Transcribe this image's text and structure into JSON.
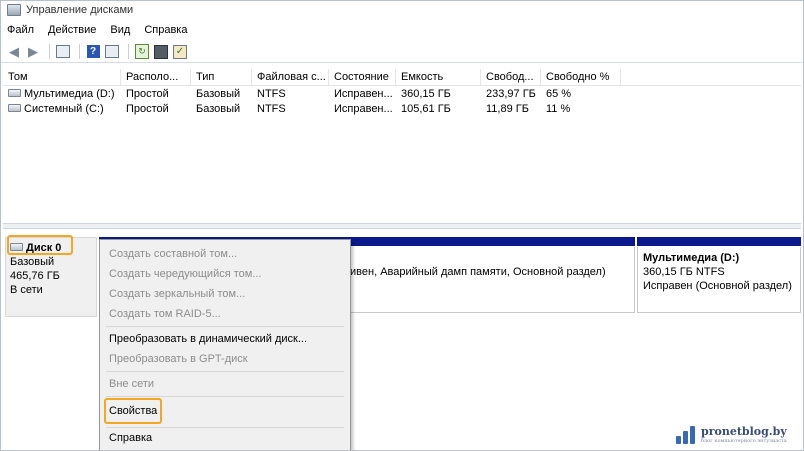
{
  "window": {
    "title": "Управление дисками"
  },
  "menu": [
    "Файл",
    "Действие",
    "Вид",
    "Справка"
  ],
  "volume_list": {
    "columns": [
      "Том",
      "Располо...",
      "Тип",
      "Файловая с...",
      "Состояние",
      "Емкость",
      "Свобод...",
      "Свободно %"
    ],
    "rows": [
      [
        "Мультимедиа (D:)",
        "Простой",
        "Базовый",
        "NTFS",
        "Исправен...",
        "360,15 ГБ",
        "233,97 ГБ",
        "65 %"
      ],
      [
        "Системный (C:)",
        "Простой",
        "Базовый",
        "NTFS",
        "Исправен...",
        "105,61 ГБ",
        "11,89 ГБ",
        "11 %"
      ]
    ]
  },
  "disk": {
    "name": "Диск 0",
    "type": "Базовый",
    "size": "465,76 ГБ",
    "status": "В сети",
    "partition_c_status": "тивен, Аварийный дамп памяти, Основной раздел)",
    "partition_d": {
      "name": "Мультимедиа  (D:)",
      "size_fs": "360,15 ГБ NTFS",
      "status": "Исправен (Основной раздел)"
    }
  },
  "context_menu": {
    "items": [
      {
        "label": "Создать составной том...",
        "enabled": false
      },
      {
        "label": "Создать чередующийся том...",
        "enabled": false
      },
      {
        "label": "Создать зеркальный том...",
        "enabled": false
      },
      {
        "label": "Создать том RAID-5...",
        "enabled": false
      },
      {
        "label": "Преобразовать в динамический диск...",
        "enabled": true
      },
      {
        "label": "Преобразовать в GPT-диск",
        "enabled": false
      },
      {
        "label": "Вне сети",
        "enabled": false
      },
      {
        "label": "Свойства",
        "enabled": true
      },
      {
        "label": "Справка",
        "enabled": true
      }
    ]
  },
  "watermark": {
    "site": "pronetblog.by",
    "tagline": "блог компьютерного энтузиаста"
  },
  "colors": {
    "highlight": "#f5a623",
    "partition_bar": "#0a1a8c",
    "disabled_text": "#8d8d8d"
  }
}
